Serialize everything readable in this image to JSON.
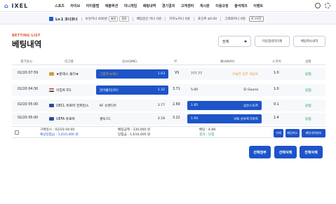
{
  "app": {
    "logo_mark": "⌂",
    "logo_text": "IXEL"
  },
  "nav": [
    "스포츠",
    "라이브",
    "티티플랩",
    "에볼루션",
    "미니게임",
    "베팅내역",
    "경기결과",
    "고객센터",
    "게시판",
    "이용규정",
    "출석체크",
    "이벤트"
  ],
  "info": {
    "level": "Lv.1 코너코너",
    "money_label": "보유머니 400원",
    "money_btn1": "충전",
    "money_btn2": "환전",
    "betting_money": "베팅중인 머니 0원",
    "casino_money": "카지노머니 0원",
    "point": "포인트 $0.00",
    "game_money": "그래프머니 0원",
    "logout": "로그아웃"
  },
  "header": {
    "subtitle": "BETTING LIST",
    "title": "베팅내역",
    "select_value": "전체",
    "btn_partial_cancel": "미당첨내역삭제",
    "btn_cancel_history": "베팅취소내역"
  },
  "columns": [
    "경기일시",
    "리그명",
    "승(HOME)",
    "무",
    "패(AWAY)",
    "스코어",
    "상태"
  ],
  "rows": [
    {
      "time": "02/20 07:59",
      "league": "★분데스 풀더★",
      "flag_color": "#c8a43a",
      "home": "그룹매 뉴에스",
      "home_odd": "1.03",
      "home_sel": true,
      "draw": "VS",
      "away": "777.77",
      "away_name": "아슬한 실한 세금투",
      "away_odd": "",
      "away_sel": false,
      "score": "1:0",
      "status": "당첨"
    },
    {
      "time": "02/20 04:30",
      "league": "이집트 D1",
      "flag_color": "#c0392b",
      "home": "알아흘리(OY)",
      "home_odd": "1.32",
      "home_sel": true,
      "draw": "3.71",
      "away": "5.00",
      "away_name": "El Gouna",
      "away_odd": "",
      "away_sel": false,
      "score": "1:0",
      "status": "당첨"
    },
    {
      "time": "02/20 05:00",
      "league": "UECL 유로파 컨퍼런스",
      "flag_color": "#2e4a9a",
      "home": "KF 슈켄디아",
      "home_odd": "3.77",
      "home_sel": false,
      "draw": "2.69",
      "away": "샴슨스포르",
      "away_name": "1.85",
      "away_odd": "",
      "away_sel": true,
      "score": "0:1",
      "status": "당첨"
    },
    {
      "time": "02/20 05:00",
      "league": "UEFA 유로파",
      "flag_color": "#2e4a9a",
      "home": "셀틱 FC",
      "home_odd": "3.18",
      "home_sel": false,
      "draw": "3.22",
      "away": "VfB 슈투트가르트",
      "away_name": "1.94",
      "away_odd": "",
      "away_sel": true,
      "score": "1:4",
      "status": "당첨"
    }
  ],
  "summary": {
    "bet_time_label": "구매일시 : 02/20 04:00",
    "expected_label": "예상당첨금 : 1,610,400 원",
    "bet_amount_label": "베팅금액 : 330,000 원",
    "win_amount_label": "당첨금 : 1,610,400 원",
    "odds_label": "배당 : 4.88",
    "result_label": "결과 : 당첨",
    "btn_delete": "삭제",
    "btn_cancel": "베팅취소",
    "btn_betslip": "베팅내역첨부"
  },
  "bottom": {
    "btn_select_attach": "선택첨부",
    "btn_select_delete": "선택삭제",
    "btn_delete_all": "전체삭제"
  },
  "colors": {
    "accent": "#1d54c8",
    "orange": "#e0582c",
    "win": "#2aa84f"
  }
}
